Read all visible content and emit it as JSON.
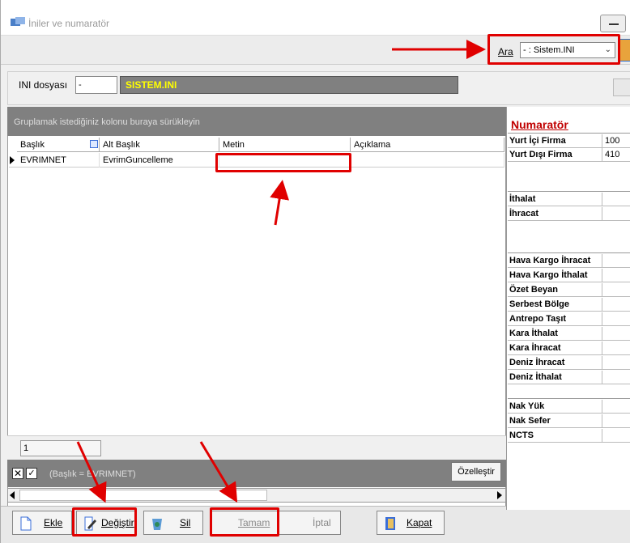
{
  "window": {
    "title": "İniler ve numaratör"
  },
  "search": {
    "label": "Ara",
    "value": "- : Sistem.INI"
  },
  "ini": {
    "label": "INI dosyası",
    "code": "-",
    "name": "SISTEM.INI"
  },
  "grid": {
    "group_hint": "Gruplamak istediğiniz kolonu buraya sürükleyin",
    "columns": [
      "Başlık",
      "Alt Başlık",
      "Metin",
      "Açıklama"
    ],
    "rows": [
      {
        "baslik": "EVRIMNET",
        "alt_baslik": "EvrimGuncelleme",
        "metin": "",
        "aciklama": ""
      }
    ],
    "footer_value": "1",
    "filter_text": "(Başlık = EVRIMNET)",
    "customize_label": "Özelleştir"
  },
  "buttons": {
    "add": "Ekle",
    "edit": "Değiştir",
    "delete": "Sil",
    "ok": "Tamam",
    "cancel": "İptal",
    "close": "Kapat"
  },
  "numarator": {
    "title": "Numaratör",
    "group1": [
      {
        "label": "Yurt İçi Firma",
        "value": "100"
      },
      {
        "label": "Yurt Dışı Firma",
        "value": "410"
      }
    ],
    "group2": [
      {
        "label": "İthalat",
        "value": ""
      },
      {
        "label": "İhracat",
        "value": ""
      }
    ],
    "group3": [
      {
        "label": "Hava Kargo İhracat",
        "value": ""
      },
      {
        "label": "Hava Kargo İthalat",
        "value": ""
      },
      {
        "label": "Özet Beyan",
        "value": ""
      },
      {
        "label": "Serbest Bölge",
        "value": ""
      },
      {
        "label": "Antrepo Taşıt",
        "value": ""
      },
      {
        "label": "Kara İthalat",
        "value": ""
      },
      {
        "label": "Kara İhracat",
        "value": ""
      },
      {
        "label": "Deniz İhracat",
        "value": ""
      },
      {
        "label": "Deniz İthalat",
        "value": ""
      }
    ],
    "group4": [
      {
        "label": "Nak Yük",
        "value": ""
      },
      {
        "label": "Nak Sefer",
        "value": ""
      },
      {
        "label": "NCTS",
        "value": ""
      }
    ]
  },
  "colors": {
    "highlight": "#e00000",
    "ini_name_text": "#ffff00",
    "numarator_title": "#c00000"
  }
}
